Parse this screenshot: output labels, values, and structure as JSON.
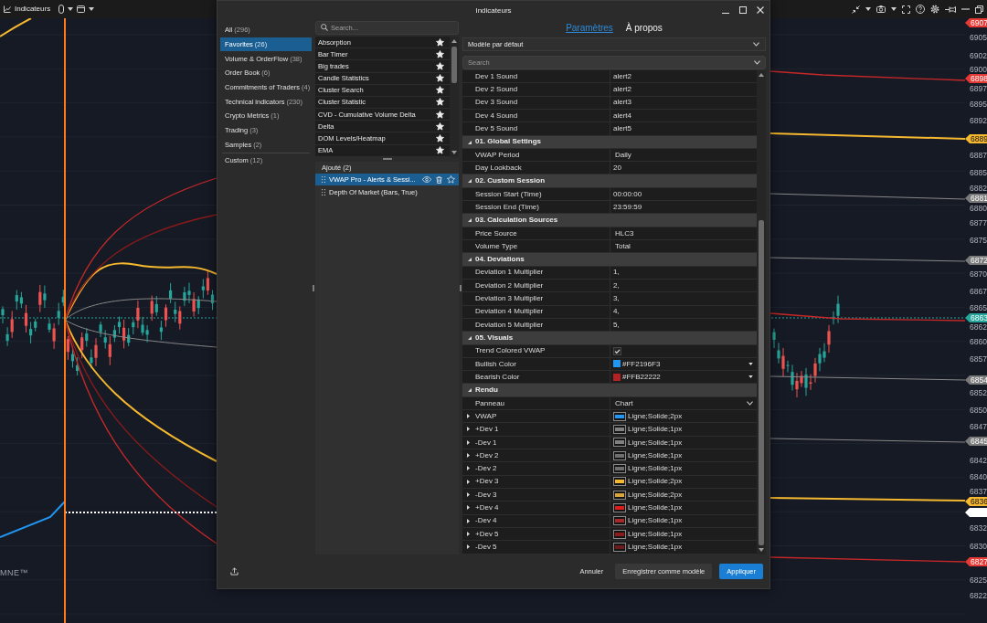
{
  "app_bar": {
    "title": "Indicateurs"
  },
  "chart": {
    "logo_text": "MNE™",
    "price_axis": {
      "ticks": [
        "6905",
        "6902",
        "6900",
        "6897",
        "6895",
        "6892",
        "6887",
        "6885",
        "6882",
        "6880",
        "6877",
        "6875",
        "6870",
        "6867",
        "6865",
        "6862",
        "6860",
        "6857",
        "6852",
        "6850",
        "6847",
        "6842",
        "6840",
        "6837",
        "6832",
        "6830",
        "6825",
        "6822"
      ],
      "tags": [
        {
          "text": "6907",
          "color": "#e53935"
        },
        {
          "text": "6898",
          "color": "#e53935"
        },
        {
          "text": "6889",
          "color": "#f5b82e"
        },
        {
          "text": "6881",
          "color": "#7a7a7a"
        },
        {
          "text": "6872",
          "color": "#7a7a7a"
        },
        {
          "text": "6863",
          "color": "#26a69a"
        },
        {
          "text": "6854",
          "color": "#7a7a7a"
        },
        {
          "text": "6845",
          "color": "#7a7a7a"
        },
        {
          "text": "6836",
          "color": "#f5b82e"
        },
        {
          "color": "#ffffff"
        },
        {
          "text": "6827",
          "color": "#e53935"
        }
      ]
    }
  },
  "dialog": {
    "title": "Indicateurs",
    "category_groups": [
      {
        "items": [
          {
            "label": "All",
            "count": "(296)",
            "selected": false
          },
          {
            "label": "Favorites",
            "count": "(26)",
            "selected": true
          },
          {
            "label": "Volume & OrderFlow",
            "count": "(38)",
            "selected": false
          },
          {
            "label": "Order Book",
            "count": "(6)",
            "selected": false
          },
          {
            "label": "Commitments of Traders",
            "count": "(4)",
            "selected": false
          },
          {
            "label": "Technical indicators",
            "count": "(230)",
            "selected": false
          },
          {
            "label": "Crypto Metrics",
            "count": "(1)",
            "selected": false
          },
          {
            "label": "Trading",
            "count": "(3)",
            "selected": false
          },
          {
            "label": "Samples",
            "count": "(2)",
            "selected": false
          }
        ]
      },
      {
        "items": [
          {
            "label": "Custom",
            "count": "(12)",
            "selected": false
          }
        ]
      }
    ],
    "search": {
      "placeholder": "Search..."
    },
    "indicators": [
      {
        "name": "Absorption",
        "favorite": true
      },
      {
        "name": "Bar Timer",
        "favorite": true
      },
      {
        "name": "Big trades",
        "favorite": true
      },
      {
        "name": "Candle Statistics",
        "favorite": true
      },
      {
        "name": "Cluster Search",
        "favorite": true
      },
      {
        "name": "Cluster Statistic",
        "favorite": true
      },
      {
        "name": "CVD - Cumulative Volume Delta",
        "favorite": true
      },
      {
        "name": "Delta",
        "favorite": true
      },
      {
        "name": "DOM Levels/Heatmap",
        "favorite": true
      },
      {
        "name": "EMA",
        "favorite": true
      }
    ],
    "added": {
      "title": "Ajouté (2)",
      "items": [
        {
          "name": "VWAP Pro - Alerts & Sessi...",
          "selected": true
        },
        {
          "name": "Depth Of Market (Bars, True)",
          "selected": false
        }
      ]
    },
    "tabs": [
      {
        "label": "Paramètres",
        "selected": true
      },
      {
        "label": "À propos",
        "selected": false
      }
    ],
    "template": {
      "value": "Modèle par défaut"
    },
    "property_search": {
      "placeholder": "Search"
    },
    "properties": {
      "rows": [
        {
          "kind": "text",
          "name": "Dev 1 Sound",
          "value": "alert2"
        },
        {
          "kind": "text",
          "name": "Dev 2 Sound",
          "value": "alert2"
        },
        {
          "kind": "text",
          "name": "Dev 3 Sound",
          "value": "alert3"
        },
        {
          "kind": "text",
          "name": "Dev 4 Sound",
          "value": "alert4"
        },
        {
          "kind": "text",
          "name": "Dev 5 Sound",
          "value": "alert5"
        }
      ],
      "categories": [
        {
          "title": "01. Global Settings",
          "expanded": true,
          "rows": [
            {
              "kind": "combo",
              "name": "VWAP Period",
              "value": "Daily"
            },
            {
              "kind": "text",
              "name": "Day Lookback",
              "value": "20"
            }
          ]
        },
        {
          "title": "02. Custom Session",
          "expanded": true,
          "rows": [
            {
              "kind": "text",
              "name": "Session Start (Time)",
              "value": "00:00:00"
            },
            {
              "kind": "text",
              "name": "Session End (Time)",
              "value": "23:59:59"
            }
          ]
        },
        {
          "title": "03. Calculation Sources",
          "expanded": true,
          "rows": [
            {
              "kind": "combo",
              "name": "Price Source",
              "value": "HLC3"
            },
            {
              "kind": "combo",
              "name": "Volume Type",
              "value": "Total"
            }
          ]
        },
        {
          "title": "04. Deviations",
          "expanded": true,
          "rows": [
            {
              "kind": "text",
              "name": "Deviation 1 Multiplier",
              "value": "1,"
            },
            {
              "kind": "text",
              "name": "Deviation 2 Multiplier",
              "value": "2,"
            },
            {
              "kind": "text",
              "name": "Deviation 3 Multiplier",
              "value": "3,"
            },
            {
              "kind": "text",
              "name": "Deviation 4 Multiplier",
              "value": "4,"
            },
            {
              "kind": "text",
              "name": "Deviation 5 Multiplier",
              "value": "5,"
            }
          ]
        },
        {
          "title": "05. Visuals",
          "expanded": true,
          "rows": [
            {
              "kind": "checkbox",
              "name": "Trend Colored VWAP",
              "checked": true
            },
            {
              "kind": "color",
              "name": "Bullish Color",
              "value": "#FF2196F3",
              "color": "#2196f3"
            },
            {
              "kind": "color",
              "name": "Bearish Color",
              "value": "#FFB22222",
              "color": "#b22222"
            }
          ]
        },
        {
          "title": "Rendu",
          "expanded": true,
          "rows": [
            {
              "kind": "dropdown",
              "name": "Panneau",
              "value": "Chart"
            },
            {
              "kind": "line",
              "name": "VWAP",
              "value": "Ligne;Solide;2px",
              "color": "#2196f3",
              "expanded": false
            },
            {
              "kind": "line",
              "name": "+Dev 1",
              "value": "Ligne;Solide;1px",
              "color": "#808080",
              "expanded": false
            },
            {
              "kind": "line",
              "name": "-Dev 1",
              "value": "Ligne;Solide;1px",
              "color": "#808080",
              "expanded": false
            },
            {
              "kind": "line",
              "name": "+Dev 2",
              "value": "Ligne;Solide;1px",
              "color": "#6e6e6e",
              "expanded": false
            },
            {
              "kind": "line",
              "name": "-Dev 2",
              "value": "Ligne;Solide;1px",
              "color": "#6e6e6e",
              "expanded": false
            },
            {
              "kind": "line",
              "name": "+Dev 3",
              "value": "Ligne;Solide;2px",
              "color": "#f5b82e",
              "expanded": false
            },
            {
              "kind": "line",
              "name": "-Dev 3",
              "value": "Ligne;Solide;2px",
              "color": "#d9a53a",
              "expanded": false
            },
            {
              "kind": "line",
              "name": "+Dev 4",
              "value": "Ligne;Solide;1px",
              "color": "#e01b1b",
              "expanded": false
            },
            {
              "kind": "line",
              "name": "-Dev 4",
              "value": "Ligne;Solide;1px",
              "color": "#a82828",
              "expanded": false
            },
            {
              "kind": "line",
              "name": "+Dev 5",
              "value": "Ligne;Solide;1px",
              "color": "#8b1a1a",
              "expanded": false
            },
            {
              "kind": "line",
              "name": "-Dev 5",
              "value": "Ligne;Solide;1px",
              "color": "#6e1a1a",
              "expanded": false
            }
          ]
        }
      ]
    },
    "buttons": [
      {
        "label": "Annuler",
        "kind": "flat"
      },
      {
        "label": "Enregistrer comme modèle",
        "kind": "default"
      },
      {
        "label": "Appliquer",
        "kind": "primary"
      }
    ]
  }
}
